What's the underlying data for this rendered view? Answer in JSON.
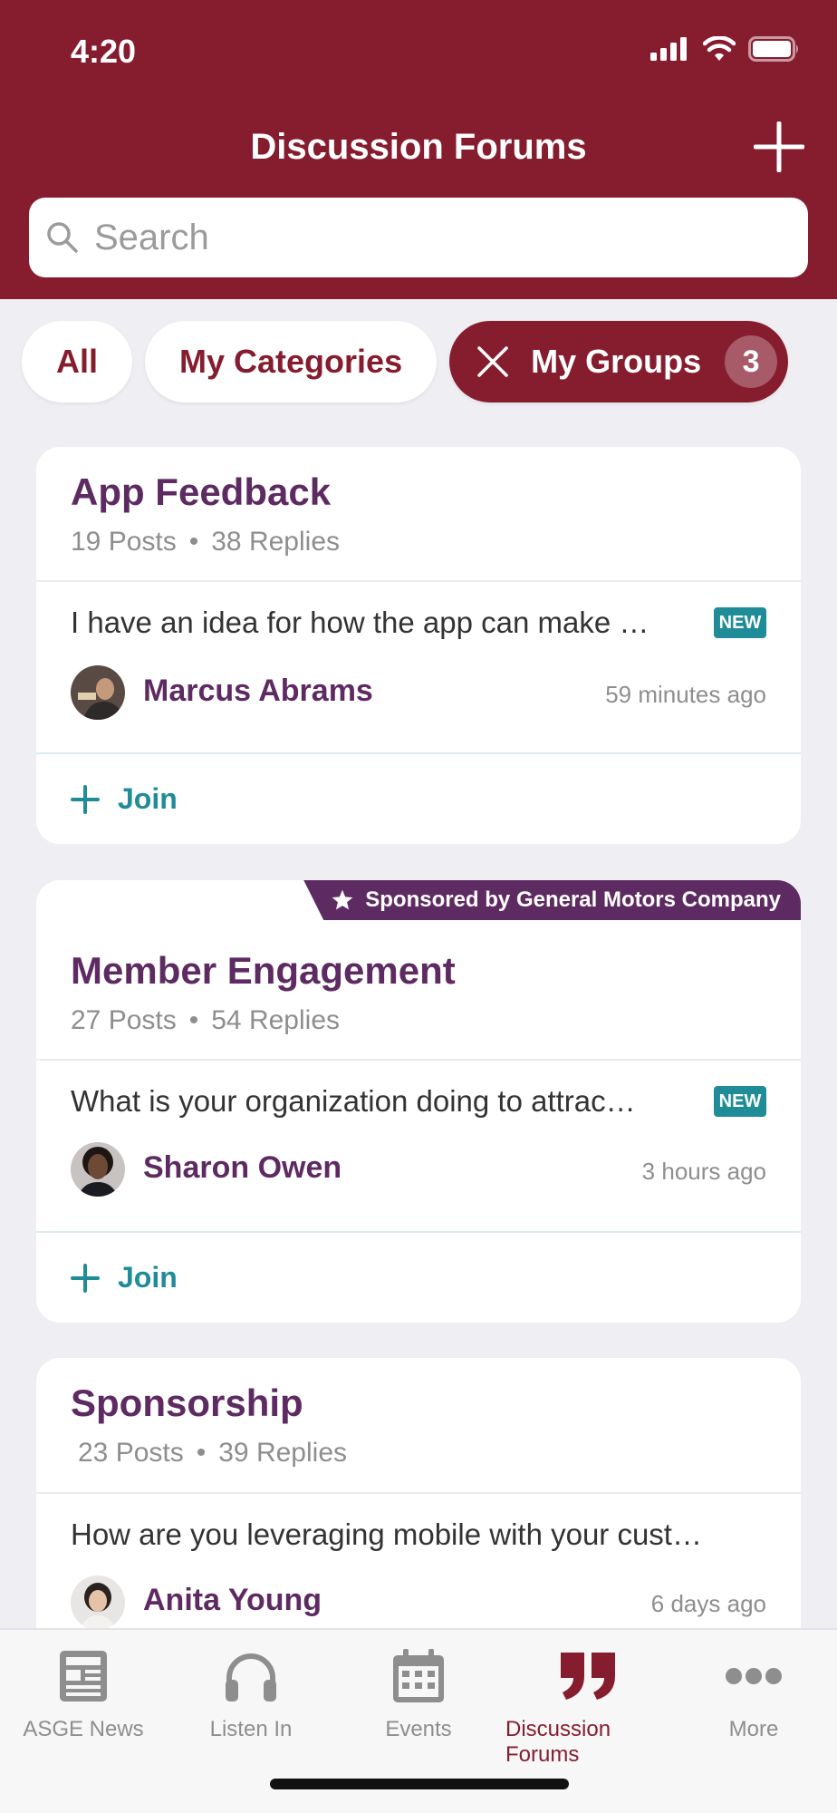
{
  "status_bar": {
    "time": "4:20"
  },
  "header": {
    "title": "Discussion Forums"
  },
  "search": {
    "placeholder": "Search"
  },
  "filters": {
    "all": "All",
    "my_categories": "My Categories",
    "my_groups": "My Groups",
    "my_groups_count": "3"
  },
  "cards": [
    {
      "title": "App Feedback",
      "posts": "19 Posts",
      "replies": "38 Replies",
      "preview": "I have an idea for how the app can make …",
      "badge": "NEW",
      "author": "Marcus Abrams",
      "time": "59 minutes ago",
      "join": "Join"
    },
    {
      "sponsor": "Sponsored by General Motors Company",
      "title": "Member Engagement",
      "posts": "27 Posts",
      "replies": "54 Replies",
      "preview": "What is your organization doing to attrac…",
      "badge": "NEW",
      "author": "Sharon Owen",
      "time": "3 hours ago",
      "join": "Join"
    },
    {
      "title": "Sponsorship",
      "posts": "23 Posts",
      "replies": "39 Replies",
      "preview": "How are you leveraging mobile with your cust…",
      "author": "Anita Young",
      "time": "6 days ago"
    }
  ],
  "tabs": [
    {
      "label": "ASGE News",
      "icon": "news-icon"
    },
    {
      "label": "Listen In",
      "icon": "headphones-icon"
    },
    {
      "label": "Events",
      "icon": "calendar-icon"
    },
    {
      "label": "Discussion Forums",
      "icon": "quote-icon",
      "active": true
    },
    {
      "label": "More",
      "icon": "more-icon"
    }
  ],
  "colors": {
    "brand": "#861d2f",
    "accent_purple": "#5e2a62",
    "teal": "#1f8c98",
    "background": "#efeef3"
  }
}
